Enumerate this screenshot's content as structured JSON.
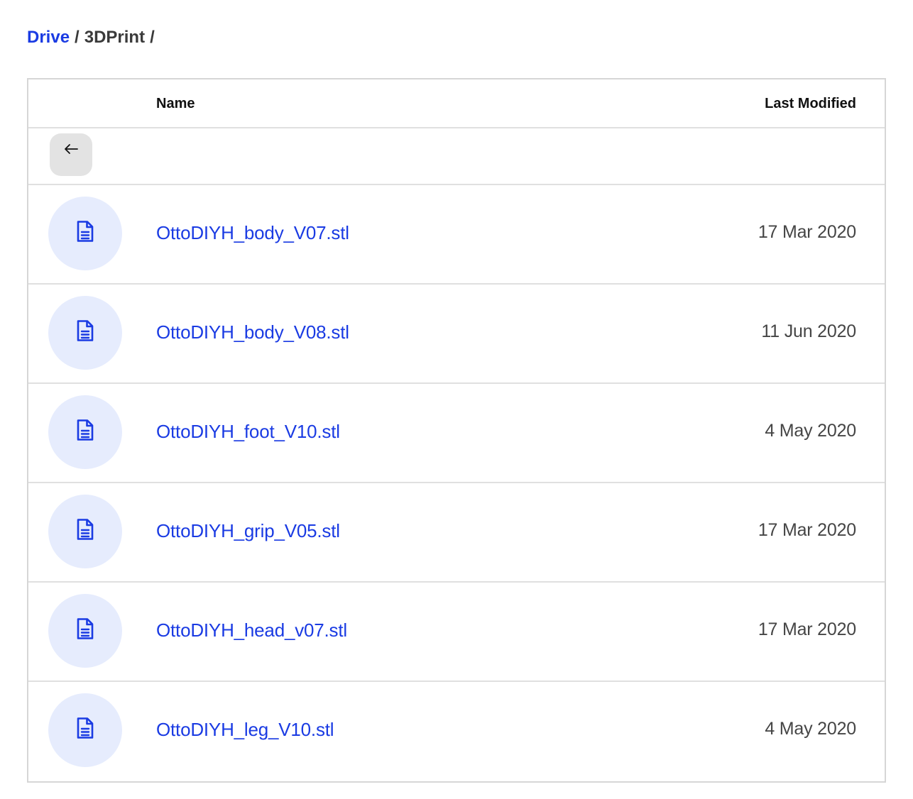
{
  "breadcrumb": {
    "root_label": "Drive",
    "separator": "/",
    "current_label": "3DPrint",
    "trailing": "/"
  },
  "table": {
    "columns": {
      "name": "Name",
      "last_modified": "Last Modified"
    },
    "back_icon": "arrow-left-icon",
    "file_icon": "file-text-icon",
    "files": [
      {
        "name": "OttoDIYH_body_V07.stl",
        "modified": "17 Mar 2020"
      },
      {
        "name": "OttoDIYH_body_V08.stl",
        "modified": "11 Jun 2020"
      },
      {
        "name": "OttoDIYH_foot_V10.stl",
        "modified": "4 May 2020"
      },
      {
        "name": "OttoDIYH_grip_V05.stl",
        "modified": "17 Mar 2020"
      },
      {
        "name": "OttoDIYH_head_v07.stl",
        "modified": "17 Mar 2020"
      },
      {
        "name": "OttoDIYH_leg_V10.stl",
        "modified": "4 May 2020"
      }
    ]
  },
  "colors": {
    "accent": "#1a3be3",
    "icon_bg": "#e6ecfd",
    "back_button_bg": "#e3e3e3",
    "border": "#d6d6d6",
    "date_text": "#454545"
  }
}
